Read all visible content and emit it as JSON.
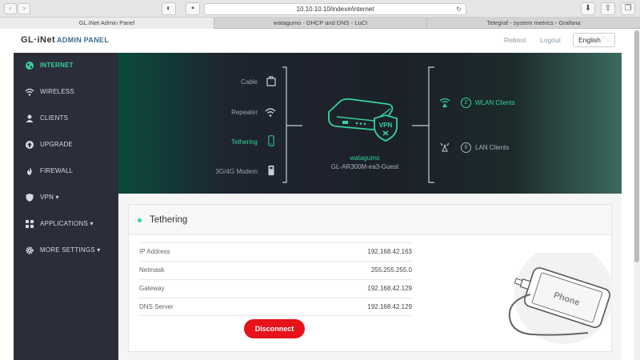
{
  "browser": {
    "url": "10.10.10.10/index#/internet",
    "tabs": [
      {
        "label": "GL.iNet Admin Panel",
        "active": true
      },
      {
        "label": "watagumo - DHCP and DNS - LuCI",
        "active": false
      },
      {
        "label": "Telegraf - system metrics - Grafana",
        "active": false
      }
    ]
  },
  "header": {
    "logo": "GL·iNet",
    "panel_title": "ADMIN PANEL",
    "reboot": "Reboot",
    "logout": "Logout",
    "language": "English"
  },
  "sidebar": {
    "items": [
      {
        "label": "INTERNET",
        "icon": "globe-icon",
        "active": true
      },
      {
        "label": "WIRELESS",
        "icon": "wifi-icon",
        "active": false
      },
      {
        "label": "CLIENTS",
        "icon": "user-icon",
        "active": false
      },
      {
        "label": "UPGRADE",
        "icon": "upload-icon",
        "active": false
      },
      {
        "label": "FIREWALL",
        "icon": "flame-icon",
        "active": false
      },
      {
        "label": "VPN ▾",
        "icon": "shield-icon",
        "active": false
      },
      {
        "label": "APPLICATIONS ▾",
        "icon": "grid-icon",
        "active": false
      },
      {
        "label": "MORE SETTINGS ▾",
        "icon": "gear-icon",
        "active": false
      }
    ]
  },
  "hero": {
    "modes": [
      {
        "label": "Cable",
        "icon": "ethernet-icon",
        "active": false
      },
      {
        "label": "Repeater",
        "icon": "wifi-icon",
        "active": false
      },
      {
        "label": "Tethering",
        "icon": "phone-icon",
        "active": true
      },
      {
        "label": "3G/4G Modem",
        "icon": "usb-modem-icon",
        "active": false
      }
    ],
    "router_name": "watagumo",
    "router_ssid": "GL-AR300M-ea3-Guest",
    "vpn_badge": "VPN",
    "clients": [
      {
        "count": "2",
        "label": "WLAN Clients",
        "icon": "wlan-antenna-icon",
        "active": true
      },
      {
        "count": "0",
        "label": "LAN Clients",
        "icon": "lan-antenna-icon",
        "active": false
      }
    ]
  },
  "tethering": {
    "title": "Tethering",
    "rows": [
      {
        "key": "IP Address",
        "value": "192.168.42.163"
      },
      {
        "key": "Netmask",
        "value": "255.255.255.0"
      },
      {
        "key": "Gateway",
        "value": "192.168.42.129"
      },
      {
        "key": "DNS Server",
        "value": "192.168.42.129"
      }
    ],
    "disconnect": "Disconnect",
    "phone_label": "Phone"
  },
  "colors": {
    "accent": "#34d39a",
    "sidebar_bg": "#2b2d3a",
    "danger": "#e6131a"
  }
}
